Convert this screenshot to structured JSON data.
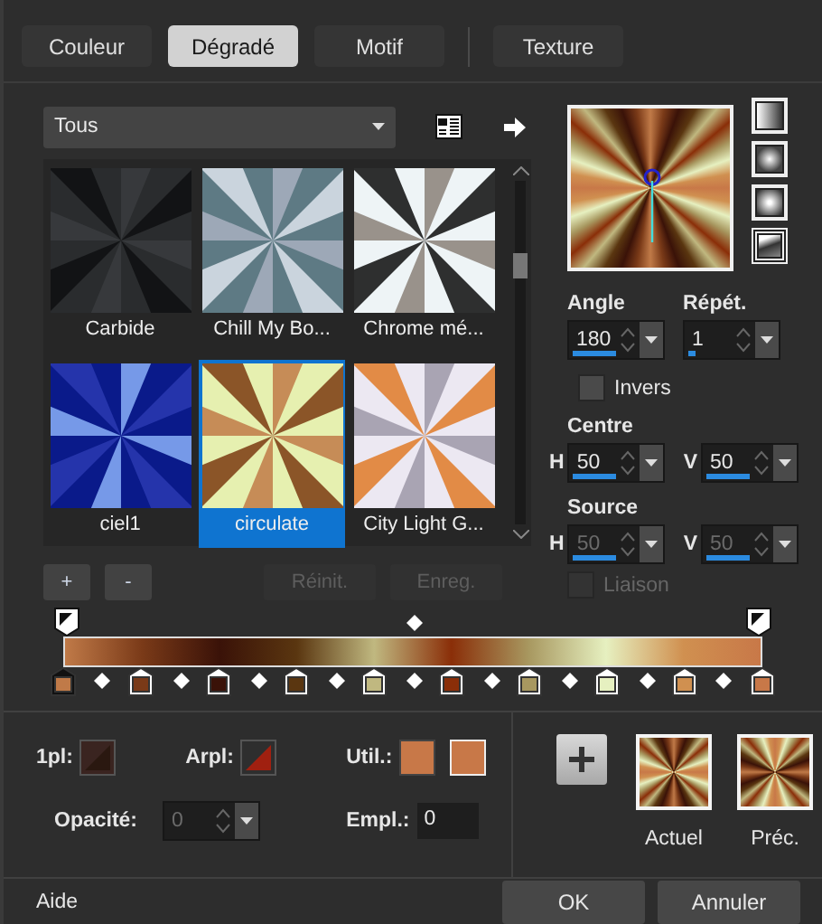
{
  "tabs": [
    {
      "label": "Couleur",
      "selected": false,
      "separator_before": false
    },
    {
      "label": "Dégradé",
      "selected": true,
      "separator_before": false
    },
    {
      "label": "Motif",
      "selected": false,
      "separator_before": false
    },
    {
      "label": "Texture",
      "selected": false,
      "separator_before": true
    }
  ],
  "category": {
    "value": "Tous"
  },
  "presets": [
    {
      "name": "Carbide",
      "selected": false
    },
    {
      "name": "Chill My Bo...",
      "selected": false
    },
    {
      "name": "Chrome mé...",
      "selected": false
    },
    {
      "name": "ciel1",
      "selected": false
    },
    {
      "name": "circulate",
      "selected": true
    },
    {
      "name": "City Light G...",
      "selected": false
    }
  ],
  "preset_buttons": [
    {
      "label": "+",
      "disabled": false
    },
    {
      "label": "-",
      "disabled": false
    },
    {
      "label": "Réinit.",
      "disabled": true
    },
    {
      "label": "Enreg.",
      "disabled": true
    }
  ],
  "styles": [
    {
      "kind": "linear",
      "selected": false
    },
    {
      "kind": "rectangular",
      "selected": false
    },
    {
      "kind": "radial",
      "selected": false
    },
    {
      "kind": "sunburst",
      "selected": true
    }
  ],
  "angle": {
    "label": "Angle",
    "value": "180",
    "level": 0.5
  },
  "repeat": {
    "label": "Répét.",
    "value": "1",
    "level": 0.08
  },
  "invert": {
    "label": "Invers",
    "checked": false
  },
  "center": {
    "label": "Centre",
    "h": {
      "label": "H",
      "value": "50",
      "level": 0.5,
      "disabled": false
    },
    "v": {
      "label": "V",
      "value": "50",
      "level": 0.5,
      "disabled": false
    }
  },
  "source": {
    "label": "Source",
    "h": {
      "label": "H",
      "value": "50",
      "level": 0.5,
      "disabled": true
    },
    "v": {
      "label": "V",
      "value": "50",
      "level": 0.5,
      "disabled": true
    }
  },
  "link": {
    "label": "Liaison",
    "checked": false,
    "disabled": true
  },
  "stops": [
    {
      "color": "#c07a48",
      "selected": true
    },
    {
      "color": "#7a3a18",
      "selected": false
    },
    {
      "color": "#3a1208",
      "selected": false
    },
    {
      "color": "#5a3610",
      "selected": false
    },
    {
      "color": "#c0b880",
      "selected": false
    },
    {
      "color": "#8a2e08",
      "selected": false
    },
    {
      "color": "#a89860",
      "selected": false
    },
    {
      "color": "#e6f0c0",
      "selected": false
    },
    {
      "color": "#d09050",
      "selected": false
    },
    {
      "color": "#c87848",
      "selected": false
    }
  ],
  "stop_props": {
    "foreground": {
      "label": "1pl:"
    },
    "background": {
      "label": "Arpl:"
    },
    "custom": {
      "label": "Util.:",
      "color": "#c87848"
    },
    "opacity": {
      "label": "Opacité:",
      "value": "0",
      "disabled": true
    },
    "location": {
      "label": "Empl.:",
      "value": "0"
    }
  },
  "samples": [
    {
      "label": "Actuel"
    },
    {
      "label": "Préc."
    }
  ],
  "footer": {
    "help": "Aide",
    "ok": "OK",
    "cancel": "Annuler"
  }
}
